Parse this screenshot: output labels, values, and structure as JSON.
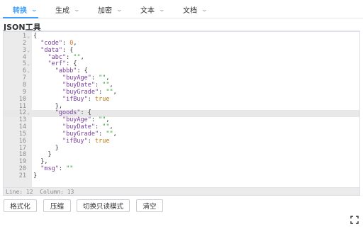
{
  "menu": {
    "items": [
      {
        "label": "转换",
        "active": true
      },
      {
        "label": "生成"
      },
      {
        "label": "加密"
      },
      {
        "label": "文本"
      },
      {
        "label": "文档"
      }
    ],
    "caret_icon": "chevron-down-icon"
  },
  "title": "JSON工具",
  "editor": {
    "active_line": 12,
    "lines": [
      {
        "n": "1",
        "fold": true,
        "tokens": [
          [
            "p",
            "{"
          ]
        ]
      },
      {
        "n": "2",
        "tokens": [
          [
            "p",
            "  "
          ],
          [
            "k",
            "\"code\""
          ],
          [
            "p",
            ": "
          ],
          [
            "n",
            "0"
          ],
          [
            "p",
            ","
          ]
        ]
      },
      {
        "n": "3",
        "fold": true,
        "tokens": [
          [
            "p",
            "  "
          ],
          [
            "k",
            "\"data\""
          ],
          [
            "p",
            ": {"
          ]
        ]
      },
      {
        "n": "4",
        "tokens": [
          [
            "p",
            "    "
          ],
          [
            "k",
            "\"abc\""
          ],
          [
            "p",
            ": "
          ],
          [
            "s",
            "\"\""
          ],
          [
            "p",
            ","
          ]
        ]
      },
      {
        "n": "5",
        "fold": true,
        "tokens": [
          [
            "p",
            "    "
          ],
          [
            "k",
            "\"erf\""
          ],
          [
            "p",
            ": {"
          ]
        ]
      },
      {
        "n": "6",
        "fold": true,
        "tokens": [
          [
            "p",
            "      "
          ],
          [
            "k",
            "\"abbb\""
          ],
          [
            "p",
            ": {"
          ]
        ]
      },
      {
        "n": "7",
        "tokens": [
          [
            "p",
            "        "
          ],
          [
            "k",
            "\"buyAge\""
          ],
          [
            "p",
            ": "
          ],
          [
            "s",
            "\"\""
          ],
          [
            "p",
            ","
          ]
        ]
      },
      {
        "n": "8",
        "tokens": [
          [
            "p",
            "        "
          ],
          [
            "k",
            "\"buyDate\""
          ],
          [
            "p",
            ": "
          ],
          [
            "s",
            "\"\""
          ],
          [
            "p",
            ","
          ]
        ]
      },
      {
        "n": "9",
        "tokens": [
          [
            "p",
            "        "
          ],
          [
            "k",
            "\"buyGrade\""
          ],
          [
            "p",
            ": "
          ],
          [
            "s",
            "\"\""
          ],
          [
            "p",
            ","
          ]
        ]
      },
      {
        "n": "10",
        "tokens": [
          [
            "p",
            "        "
          ],
          [
            "k",
            "\"ifBuy\""
          ],
          [
            "p",
            ": "
          ],
          [
            "b",
            "true"
          ]
        ]
      },
      {
        "n": "11",
        "tokens": [
          [
            "p",
            "      },"
          ]
        ]
      },
      {
        "n": "12",
        "fold": true,
        "tokens": [
          [
            "p",
            "      "
          ],
          [
            "k",
            "\"goods\""
          ],
          [
            "p",
            ": {"
          ]
        ]
      },
      {
        "n": "13",
        "tokens": [
          [
            "p",
            "        "
          ],
          [
            "k",
            "\"buyAge\""
          ],
          [
            "p",
            ": "
          ],
          [
            "s",
            "\"\""
          ],
          [
            "p",
            ","
          ]
        ]
      },
      {
        "n": "14",
        "tokens": [
          [
            "p",
            "        "
          ],
          [
            "k",
            "\"buyDate\""
          ],
          [
            "p",
            ": "
          ],
          [
            "s",
            "\"\""
          ],
          [
            "p",
            ","
          ]
        ]
      },
      {
        "n": "15",
        "tokens": [
          [
            "p",
            "        "
          ],
          [
            "k",
            "\"buyGrade\""
          ],
          [
            "p",
            ": "
          ],
          [
            "s",
            "\"\""
          ],
          [
            "p",
            ","
          ]
        ]
      },
      {
        "n": "16",
        "tokens": [
          [
            "p",
            "        "
          ],
          [
            "k",
            "\"ifBuy\""
          ],
          [
            "p",
            ": "
          ],
          [
            "b",
            "true"
          ]
        ]
      },
      {
        "n": "17",
        "tokens": [
          [
            "p",
            "      }"
          ]
        ]
      },
      {
        "n": "18",
        "tokens": [
          [
            "p",
            "    }"
          ]
        ]
      },
      {
        "n": "19",
        "tokens": [
          [
            "p",
            "  },"
          ]
        ]
      },
      {
        "n": "20",
        "tokens": [
          [
            "p",
            "  "
          ],
          [
            "k",
            "\"msg\""
          ],
          [
            "p",
            ": "
          ],
          [
            "s",
            "\"\""
          ]
        ]
      },
      {
        "n": "21",
        "tokens": [
          [
            "p",
            "}"
          ]
        ]
      }
    ],
    "status": "Line: 12  Column: 13"
  },
  "buttons": {
    "format": "格式化",
    "compress": "压缩",
    "toggle_readonly": "切换只读模式",
    "clear": "清空"
  },
  "fullscreen_icon": "fullscreen-icon"
}
